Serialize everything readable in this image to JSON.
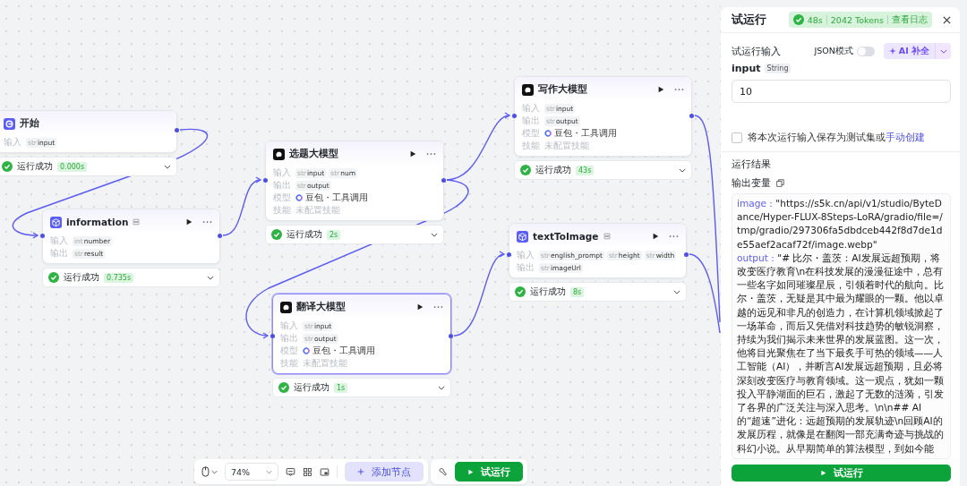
{
  "nodes": [
    {
      "kind": "start",
      "title": "开始",
      "selected": false,
      "rows": [
        {
          "kind": "vars",
          "label": "输入",
          "tags": [
            {
              "type": "str",
              "name": "input"
            }
          ]
        }
      ],
      "status": "运行成功",
      "time": "0.000s"
    },
    {
      "kind": "plugin",
      "title": "information",
      "selected": false,
      "rows": [
        {
          "kind": "vars",
          "label": "输入",
          "tags": [
            {
              "type": "int",
              "name": "number"
            }
          ]
        },
        {
          "kind": "vars",
          "label": "输出",
          "tags": [
            {
              "type": "str",
              "name": "result"
            }
          ]
        }
      ],
      "status": "运行成功",
      "time": "0.735s"
    },
    {
      "kind": "llm",
      "title": "选题大模型",
      "selected": false,
      "rows": [
        {
          "kind": "vars",
          "label": "输入",
          "tags": [
            {
              "type": "str",
              "name": "input"
            },
            {
              "type": "str",
              "name": "num"
            }
          ]
        },
        {
          "kind": "vars",
          "label": "输出",
          "tags": [
            {
              "type": "str",
              "name": "output"
            }
          ]
        },
        {
          "kind": "model",
          "label": "模型",
          "text": "豆包・工具调用"
        },
        {
          "kind": "text",
          "label": "技能",
          "text": "未配置技能"
        }
      ],
      "status": "运行成功",
      "time": "2s"
    },
    {
      "kind": "llm",
      "title": "写作大模型",
      "selected": false,
      "rows": [
        {
          "kind": "vars",
          "label": "输入",
          "tags": [
            {
              "type": "str",
              "name": "input"
            }
          ]
        },
        {
          "kind": "vars",
          "label": "输出",
          "tags": [
            {
              "type": "str",
              "name": "output"
            }
          ]
        },
        {
          "kind": "model",
          "label": "模型",
          "text": "豆包・工具调用"
        },
        {
          "kind": "text",
          "label": "技能",
          "text": "未配置技能"
        }
      ],
      "status": "运行成功",
      "time": "43s"
    },
    {
      "kind": "plugin",
      "title": "textToImage",
      "selected": false,
      "rows": [
        {
          "kind": "vars",
          "label": "输入",
          "tags": [
            {
              "type": "str",
              "name": "english_prompt"
            },
            {
              "type": "str",
              "name": "height"
            },
            {
              "type": "str",
              "name": "width"
            }
          ]
        },
        {
          "kind": "vars",
          "label": "输出",
          "tags": [
            {
              "type": "str",
              "name": "imageUrl"
            }
          ]
        }
      ],
      "status": "运行成功",
      "time": "8s"
    },
    {
      "kind": "llm",
      "title": "翻译大模型",
      "selected": true,
      "rows": [
        {
          "kind": "vars",
          "label": "输入",
          "tags": [
            {
              "type": "str",
              "name": "input"
            }
          ]
        },
        {
          "kind": "vars",
          "label": "输出",
          "tags": [
            {
              "type": "str",
              "name": "output"
            }
          ]
        },
        {
          "kind": "model",
          "label": "模型",
          "text": "豆包・工具调用"
        },
        {
          "kind": "text",
          "label": "技能",
          "text": "未配置技能"
        }
      ],
      "status": "运行成功",
      "time": "1s"
    }
  ],
  "toolbar": {
    "zoom": "74%",
    "add_node": "添加节点",
    "run": "试运行"
  },
  "panel": {
    "title": "试运行",
    "summary": {
      "time": "48s",
      "tokens": "2042 Tokens",
      "log_link": "查看日志"
    },
    "input_heading": "试运行输入",
    "json_mode": {
      "label": "JSON模式",
      "on": false
    },
    "ai_button": "AI 补全",
    "input": {
      "name": "input",
      "type": "String",
      "value": "10"
    },
    "save": {
      "checked": false,
      "text": "将本次运行输入保存为测试集或",
      "link": "手动创建"
    },
    "result_heading": "运行结果",
    "output_heading": "输出变量",
    "outputs": [
      {
        "key": "image :",
        "value": "\"https://s5k.cn/api/v1/studio/ByteDance/Hyper-FLUX-8Steps-LoRA/gradio/file=/tmp/gradio/297306fa5dbdceb442f8d7de1de55aef2acaf72f/image.webp\""
      },
      {
        "key": "output :",
        "value": "\"# 比尔・盖茨：AI发展远超预期，将改变医疗教育\\n在科技发展的漫漫征途中，总有一些名字如同璀璨星辰，引领着时代的航向。比尔・盖茨，无疑是其中最为耀眼的一颗。他以卓越的远见和非凡的创造力，在计算机领域掀起了一场革命，而后又凭借对科技趋势的敏锐洞察，持续为我们揭示未来世界的发展蓝图。这一次，他将目光聚焦在了当下最炙手可热的领域——人工智能（AI），并断言AI发展远超预期，且必将深刻改变医疗与教育领域。这一观点，犹如一颗投入平静湖面的巨石，激起了无数的涟漪，引发了各界的广泛关注与深入思考。\\n\\n## AI的“超速”进化：远超预期的发展轨迹\\n回顾AI的发展历程，就像是在翻阅一部充满奇迹与挑战的科幻小说。从早期简单的算法模型，到如今能"
      }
    ],
    "run_button": "试运行"
  }
}
